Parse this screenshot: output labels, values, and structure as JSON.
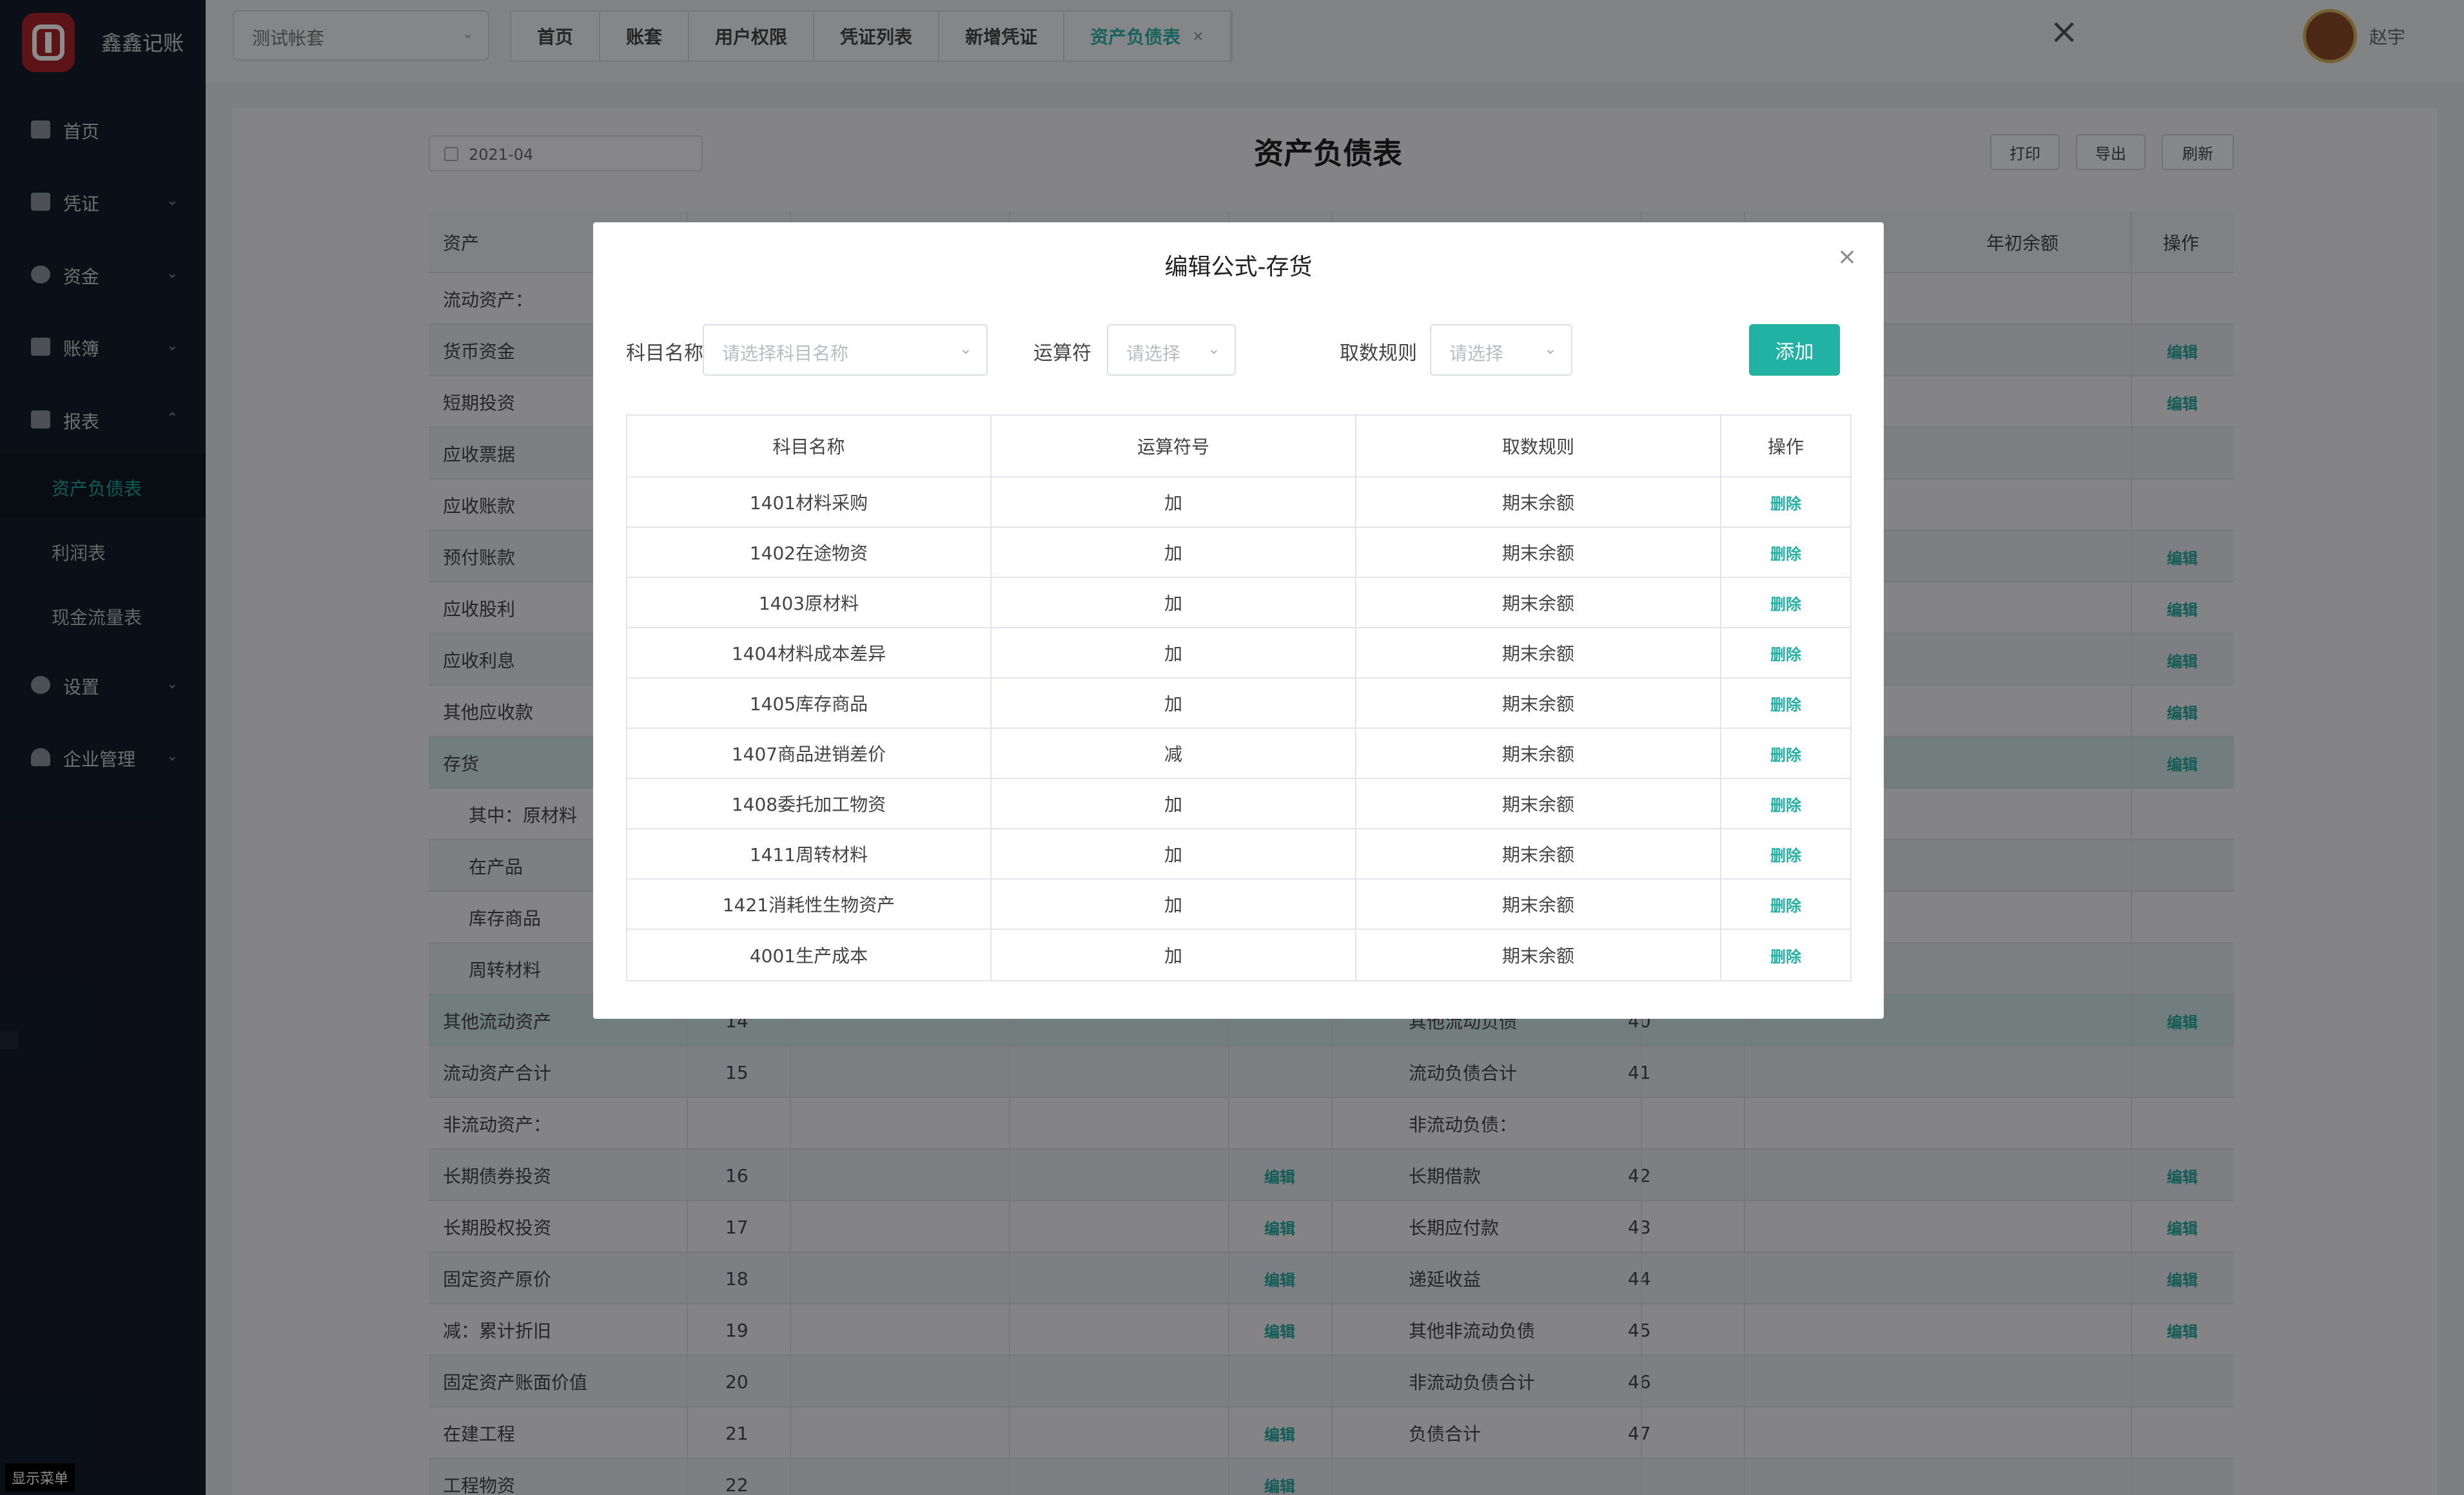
{
  "app": {
    "name": "鑫鑫记账",
    "show_menu": "显示菜单"
  },
  "sidebar": {
    "items": [
      {
        "label": "首页",
        "icon": "home-icon"
      },
      {
        "label": "凭证",
        "icon": "voucher-icon"
      },
      {
        "label": "资金",
        "icon": "fund-icon"
      },
      {
        "label": "账簿",
        "icon": "ledger-icon"
      },
      {
        "label": "报表",
        "icon": "report-icon"
      },
      {
        "label": "设置",
        "icon": "gear-icon"
      },
      {
        "label": "企业管理",
        "icon": "user-icon"
      }
    ],
    "sub_items": [
      "资产负债表",
      "利润表",
      "现金流量表"
    ]
  },
  "topbar": {
    "account": "测试帐套",
    "tabs": [
      "首页",
      "账套",
      "用户权限",
      "凭证列表",
      "新增凭证",
      "资产负债表"
    ],
    "user": "赵宇"
  },
  "report": {
    "date": "2021-04",
    "title": "资产负债表",
    "print": "打印",
    "export": "导出",
    "refresh": "刷新",
    "headers": {
      "asset": "资产",
      "begin_balance": "年初余额",
      "action": "操作"
    },
    "edit": "编辑",
    "left_rows": [
      "流动资产：",
      "货币资金",
      "短期投资",
      "应收票据",
      "应收账款",
      "预付账款",
      "应收股利",
      "应收利息",
      "其他应收款",
      "存货",
      "其中：原材料",
      "在产品",
      "库存商品",
      "周转材料",
      "其他流动资产",
      "流动资产合计",
      "非流动资产：",
      "长期债券投资",
      "长期股权投资",
      "固定资产原价",
      "减：累计折旧",
      "固定资产账面价值",
      "在建工程",
      "工程物资"
    ],
    "left_lines": [
      "",
      "",
      "",
      "",
      "",
      "",
      "",
      "",
      "",
      "",
      "",
      "",
      "",
      "",
      "14",
      "15",
      "",
      "16",
      "17",
      "18",
      "19",
      "20",
      "21",
      "22"
    ],
    "right_rows": [
      "其他流动负债",
      "流动负债合计",
      "非流动负债：",
      "长期借款",
      "长期应付款",
      "递延收益",
      "其他非流动负债",
      "非流动负债合计",
      "负债合计"
    ],
    "right_lines": [
      "40",
      "41",
      "",
      "42",
      "43",
      "44",
      "45",
      "46",
      "47"
    ]
  },
  "modal": {
    "title": "编辑公式-存货",
    "subject_label": "科目名称",
    "subject_placeholder": "请选择科目名称",
    "operator_label": "运算符",
    "operator_placeholder": "请选择",
    "rule_label": "取数规则",
    "rule_placeholder": "请选择",
    "add": "添加",
    "columns": [
      "科目名称",
      "运算符号",
      "取数规则",
      "操作"
    ],
    "delete": "删除",
    "rows": [
      {
        "subject": "1401材料采购",
        "op": "加",
        "rule": "期末余额"
      },
      {
        "subject": "1402在途物资",
        "op": "加",
        "rule": "期末余额"
      },
      {
        "subject": "1403原材料",
        "op": "加",
        "rule": "期末余额"
      },
      {
        "subject": "1404材料成本差异",
        "op": "加",
        "rule": "期末余额"
      },
      {
        "subject": "1405库存商品",
        "op": "加",
        "rule": "期末余额"
      },
      {
        "subject": "1407商品进销差价",
        "op": "减",
        "rule": "期末余额"
      },
      {
        "subject": "1408委托加工物资",
        "op": "加",
        "rule": "期末余额"
      },
      {
        "subject": "1411周转材料",
        "op": "加",
        "rule": "期末余额"
      },
      {
        "subject": "1421消耗性生物资产",
        "op": "加",
        "rule": "期末余额"
      },
      {
        "subject": "4001生产成本",
        "op": "加",
        "rule": "期末余额"
      }
    ]
  },
  "colors": {
    "accent": "#21b2a3",
    "sidebar_bg": "#151c2c",
    "overlay": "rgba(0,0,0,0.45)"
  }
}
